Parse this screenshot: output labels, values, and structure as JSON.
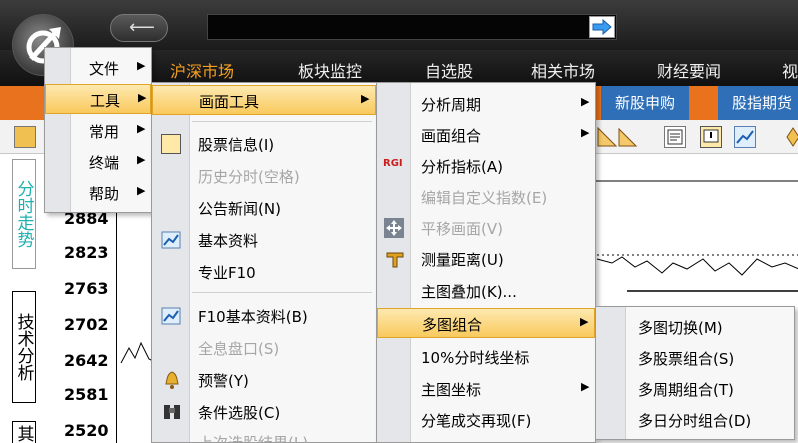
{
  "menubar": {
    "items": [
      "沪深市场",
      "板块监控",
      "自选股",
      "相关市场",
      "财经要闻",
      "视"
    ]
  },
  "tabbar": {
    "items": [
      "新股申购",
      "股指期货"
    ]
  },
  "sidebar": {
    "tabs": [
      "分时走势",
      "技术分析",
      "其"
    ]
  },
  "prices": [
    "2884",
    "2823",
    "2763",
    "2702",
    "2642",
    "2581",
    "2520"
  ],
  "main_menu": {
    "items": [
      {
        "label": "文件"
      },
      {
        "label": "工具"
      },
      {
        "label": "常用"
      },
      {
        "label": "终端"
      },
      {
        "label": "帮助"
      }
    ]
  },
  "tools_menu": {
    "items": [
      {
        "label": "画面工具"
      },
      {
        "label": "股票信息(I)"
      },
      {
        "label": "历史分时(空格)"
      },
      {
        "label": "公告新闻(N)"
      },
      {
        "label": "基本资料"
      },
      {
        "label": "专业F10"
      },
      {
        "label": "F10基本资料(B)"
      },
      {
        "label": "全息盘口(S)"
      },
      {
        "label": "预警(Y)"
      },
      {
        "label": "条件选股(C)"
      },
      {
        "label": "上次选股结果(L)"
      }
    ]
  },
  "screen_menu": {
    "items": [
      {
        "label": "分析周期"
      },
      {
        "label": "画面组合"
      },
      {
        "label": "分析指标(A)"
      },
      {
        "label": "编辑自定义指数(E)"
      },
      {
        "label": "平移画面(V)"
      },
      {
        "label": "测量距离(U)"
      },
      {
        "label": "主图叠加(K)..."
      },
      {
        "label": "多图组合"
      },
      {
        "label": "10%分时线坐标"
      },
      {
        "label": "主图坐标"
      },
      {
        "label": "分笔成交再现(F)"
      }
    ]
  },
  "multi_menu": {
    "items": [
      {
        "label": "多图切换(M)"
      },
      {
        "label": "多股票组合(S)"
      },
      {
        "label": "多周期组合(T)"
      },
      {
        "label": "多日分时组合(D)"
      }
    ]
  },
  "icons": {
    "rgi": "RGI"
  }
}
